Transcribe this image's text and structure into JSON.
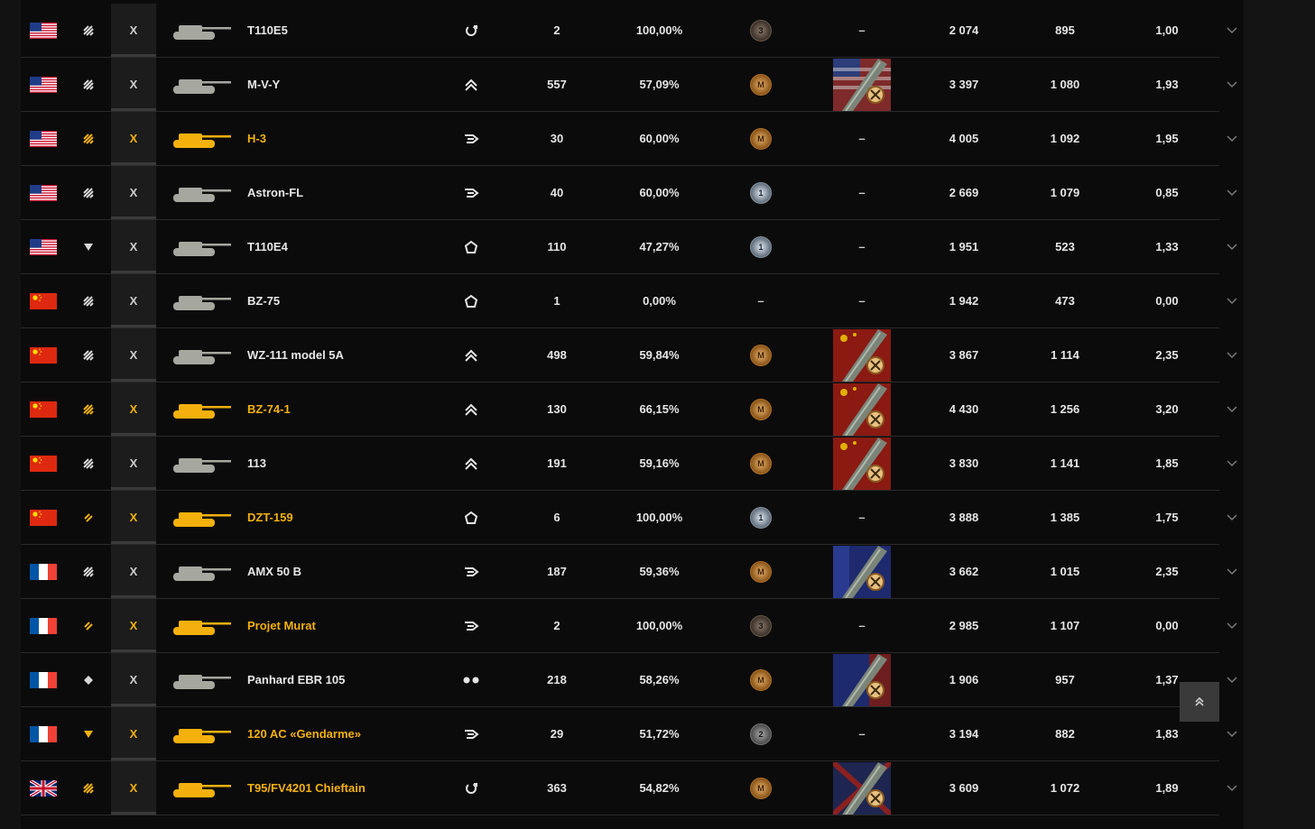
{
  "colors": {
    "premium": "#f4b10d",
    "normal": "#e8e8e8",
    "background": "#0b0b0b"
  },
  "scroll_top_icon": "double-chevron-up-icon",
  "expand_icon": "chevron-down-icon",
  "rows": [
    {
      "nation": "usa",
      "role": "heavy-stripes",
      "tier": "X",
      "premium": false,
      "name": "T110E5",
      "class": "heavy-assault",
      "battles": "2",
      "wr": "100,00%",
      "mastery": "3",
      "moe": "–",
      "moe_img": null,
      "dmg": "2 074",
      "xp": "895",
      "kd": "1,00"
    },
    {
      "nation": "usa",
      "role": "heavy-stripes",
      "tier": "X",
      "premium": false,
      "name": "M-V-Y",
      "class": "double-chevron",
      "battles": "557",
      "wr": "57,09%",
      "mastery": "M",
      "moe": "",
      "moe_img": "usa",
      "dmg": "3 397",
      "xp": "1 080",
      "kd": "1,93"
    },
    {
      "nation": "usa",
      "role": "heavy-stripes",
      "tier": "X",
      "premium": true,
      "name": "H-3",
      "class": "flank",
      "battles": "30",
      "wr": "60,00%",
      "mastery": "M",
      "moe": "–",
      "moe_img": null,
      "dmg": "4 005",
      "xp": "1 092",
      "kd": "1,95"
    },
    {
      "nation": "usa",
      "role": "heavy-stripes",
      "tier": "X",
      "premium": false,
      "name": "Astron-FL",
      "class": "flank",
      "battles": "40",
      "wr": "60,00%",
      "mastery": "1",
      "moe": "–",
      "moe_img": null,
      "dmg": "2 669",
      "xp": "1 079",
      "kd": "0,85"
    },
    {
      "nation": "usa",
      "role": "triangle",
      "tier": "X",
      "premium": false,
      "name": "T110E4",
      "class": "pentagon",
      "battles": "110",
      "wr": "47,27%",
      "mastery": "1",
      "moe": "–",
      "moe_img": null,
      "dmg": "1 951",
      "xp": "523",
      "kd": "1,33"
    },
    {
      "nation": "china",
      "role": "heavy-stripes",
      "tier": "X",
      "premium": false,
      "name": "BZ-75",
      "class": "pentagon",
      "battles": "1",
      "wr": "0,00%",
      "mastery": "–",
      "moe": "–",
      "moe_img": null,
      "dmg": "1 942",
      "xp": "473",
      "kd": "0,00"
    },
    {
      "nation": "china",
      "role": "heavy-stripes",
      "tier": "X",
      "premium": false,
      "name": "WZ-111 model 5A",
      "class": "double-chevron",
      "battles": "498",
      "wr": "59,84%",
      "mastery": "M",
      "moe": "",
      "moe_img": "china",
      "dmg": "3 867",
      "xp": "1 114",
      "kd": "2,35"
    },
    {
      "nation": "china",
      "role": "heavy-stripes",
      "tier": "X",
      "premium": true,
      "name": "BZ-74-1",
      "class": "double-chevron",
      "battles": "130",
      "wr": "66,15%",
      "mastery": "M",
      "moe": "",
      "moe_img": "china",
      "dmg": "4 430",
      "xp": "1 256",
      "kd": "3,20"
    },
    {
      "nation": "china",
      "role": "heavy-stripes",
      "tier": "X",
      "premium": false,
      "name": "113",
      "class": "double-chevron",
      "battles": "191",
      "wr": "59,16%",
      "mastery": "M",
      "moe": "",
      "moe_img": "china",
      "dmg": "3 830",
      "xp": "1 141",
      "kd": "1,85"
    },
    {
      "nation": "china",
      "role": "medium-stripes",
      "tier": "X",
      "premium": true,
      "name": "DZT-159",
      "class": "pentagon",
      "battles": "6",
      "wr": "100,00%",
      "mastery": "1",
      "moe": "–",
      "moe_img": null,
      "dmg": "3 888",
      "xp": "1 385",
      "kd": "1,75"
    },
    {
      "nation": "france",
      "role": "heavy-stripes",
      "tier": "X",
      "premium": false,
      "name": "AMX 50 B",
      "class": "flank",
      "battles": "187",
      "wr": "59,36%",
      "mastery": "M",
      "moe": "",
      "moe_img": "france",
      "dmg": "3 662",
      "xp": "1 015",
      "kd": "2,35"
    },
    {
      "nation": "france",
      "role": "medium-stripes",
      "tier": "X",
      "premium": true,
      "name": "Projet Murat",
      "class": "flank",
      "battles": "2",
      "wr": "100,00%",
      "mastery": "3",
      "moe": "–",
      "moe_img": null,
      "dmg": "2 985",
      "xp": "1 107",
      "kd": "0,00"
    },
    {
      "nation": "france",
      "role": "diamond",
      "tier": "X",
      "premium": false,
      "name": "Panhard EBR 105",
      "class": "wheels",
      "battles": "218",
      "wr": "58,26%",
      "mastery": "M",
      "moe": "",
      "moe_img": "france2",
      "dmg": "1 906",
      "xp": "957",
      "kd": "1,37"
    },
    {
      "nation": "france",
      "role": "triangle",
      "tier": "X",
      "premium": true,
      "name": "120 AC «Gendarme»",
      "class": "flank",
      "battles": "29",
      "wr": "51,72%",
      "mastery": "2",
      "moe": "–",
      "moe_img": null,
      "dmg": "3 194",
      "xp": "882",
      "kd": "1,83"
    },
    {
      "nation": "uk",
      "role": "heavy-stripes",
      "tier": "X",
      "premium": true,
      "name": "T95/FV4201 Chieftain",
      "class": "heavy-assault",
      "battles": "363",
      "wr": "54,82%",
      "mastery": "M",
      "moe": "",
      "moe_img": "uk",
      "dmg": "3 609",
      "xp": "1 072",
      "kd": "1,89"
    }
  ]
}
